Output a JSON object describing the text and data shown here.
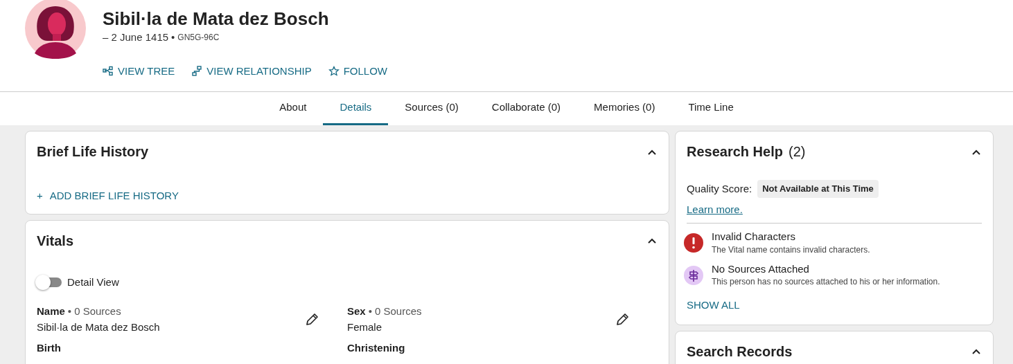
{
  "person": {
    "name": "Sibil·la de Mata dez Bosch",
    "dates": "– 2 June 1415",
    "separator": "•",
    "id": "GN5G-96C"
  },
  "actions": [
    {
      "kind": "tree",
      "label": "VIEW TREE"
    },
    {
      "kind": "relationship",
      "label": "VIEW RELATIONSHIP"
    },
    {
      "kind": "follow",
      "label": "FOLLOW"
    }
  ],
  "tabs": [
    {
      "label": "About",
      "selected": false
    },
    {
      "label": "Details",
      "selected": true
    },
    {
      "label": "Sources (0)",
      "selected": false
    },
    {
      "label": "Collaborate (0)",
      "selected": false
    },
    {
      "label": "Memories (0)",
      "selected": false
    },
    {
      "label": "Time Line",
      "selected": false
    }
  ],
  "brief_life_history": {
    "title": "Brief Life History",
    "expanded": true,
    "add_link": "ADD BRIEF LIFE HISTORY",
    "add_icon": "+"
  },
  "vitals": {
    "title": "Vitals",
    "expanded": true,
    "detail_view": {
      "label": "Detail View",
      "on": false
    },
    "facts": [
      {
        "label": "Name",
        "separator": "•",
        "sources": "0 Sources",
        "value": "Sibil·la de Mata dez Bosch"
      },
      {
        "label": "Sex",
        "separator": "•",
        "sources": "0 Sources",
        "value": "Female"
      },
      {
        "label": "Birth"
      },
      {
        "label": "Christening"
      }
    ]
  },
  "research_help": {
    "title": "Research Help",
    "count": "(2)",
    "expanded": true,
    "quality_label": "Quality Score:",
    "quality_value": "Not Available at This Time",
    "learn_more": "Learn more.",
    "issues": [
      {
        "kind": "error",
        "title": "Invalid Characters",
        "description": "The Vital name contains invalid characters."
      },
      {
        "kind": "sources",
        "title": "No Sources Attached",
        "description": "This person has no sources attached to his or her information."
      }
    ],
    "show_all": "SHOW ALL"
  },
  "search_records": {
    "title": "Search Records",
    "expanded": true
  }
}
